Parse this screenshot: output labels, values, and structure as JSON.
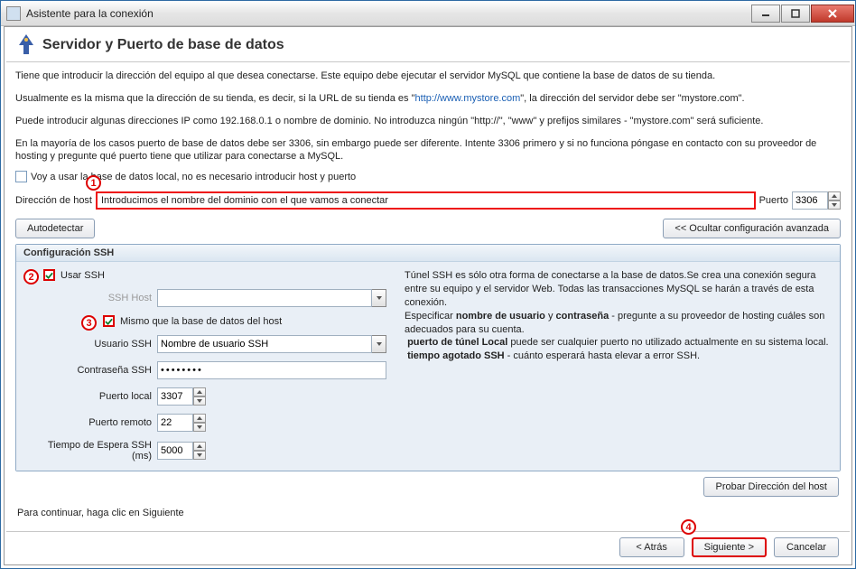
{
  "window": {
    "title": "Asistente para la conexión"
  },
  "heading": "Servidor y Puerto de base de datos",
  "intro": {
    "p1": "Tiene que introducir la dirección del equipo al que desea conectarse. Este equipo debe ejecutar el servidor MySQL que contiene la base de datos de su tienda.",
    "p2_pre": "Usualmente es la misma que la dirección de su tienda, es decir, si la URL de su tienda es \"",
    "p2_link": "http://www.mystore.com",
    "p2_post": "\", la dirección del servidor debe ser \"mystore.com\".",
    "p3": "Puede introducir algunas direcciones IP como 192.168.0.1 o nombre de dominio. No introduzca ningún \"http://\", \"www\" y prefijos similares - \"mystore.com\" será suficiente.",
    "p4": "En la mayoría de los casos puerto de base de datos debe ser 3306, sin embargo puede ser diferente. Intente 3306 primero y si no funciona póngase en contacto con su proveedor de hosting y pregunte qué puerto tiene que utilizar para conectarse a MySQL."
  },
  "localdb": {
    "label": "Voy a usar la base de datos local, no es necesario introducir host y puerto",
    "checked": false
  },
  "host": {
    "label": "Dirección de host",
    "value": "Introducimos el nombre del dominio con el que vamos a conectar",
    "port_label": "Puerto",
    "port_value": "3306"
  },
  "autodetect": "Autodetectar",
  "hide_adv": "<< Ocultar configuración avanzada",
  "ssh": {
    "group_title": "Configuración SSH",
    "use_ssh_label": "Usar SSH",
    "use_ssh_checked": true,
    "ssh_host_label": "SSH Host",
    "ssh_host_value": "",
    "same_host_label": "Mismo que la base de datos del host",
    "same_host_checked": true,
    "user_label": "Usuario SSH",
    "user_value": "Nombre de usuario SSH",
    "pass_label": "Contraseña SSH",
    "pass_value": "••••••••",
    "local_port_label": "Puerto local",
    "local_port_value": "3307",
    "remote_port_label": "Puerto remoto",
    "remote_port_value": "22",
    "timeout_label": "Tiempo de Espera SSH (ms)",
    "timeout_value": "5000"
  },
  "ssh_info": {
    "l1": "Túnel SSH es sólo otra forma de conectarse a la base de datos.Se crea una conexión segura entre su equipo y el servidor Web. Todas las transacciones MySQL se harán a través de esta conexión.",
    "l2_pre": "Especificar ",
    "l2_b1": "nombre de usuario",
    "l2_mid": " y ",
    "l2_b2": "contraseña",
    "l2_post": " - pregunte a su proveedor de hosting cuáles son adecuados para su cuenta.",
    "l3_b": "puerto de túnel Local",
    "l3_post": " puede ser cualquier puerto no utilizado actualmente en su sistema local.",
    "l4_b": "tiempo agotado SSH",
    "l4_post": " - cuánto esperará hasta elevar a error SSH."
  },
  "probe_btn": "Probar Dirección del host",
  "continue_hint": "Para continuar, haga clic en Siguiente",
  "buttons": {
    "back": "< Atrás",
    "next": "Siguiente >",
    "cancel": "Cancelar"
  },
  "annotations": {
    "a1": "1",
    "a2": "2",
    "a3": "3",
    "a4": "4"
  }
}
